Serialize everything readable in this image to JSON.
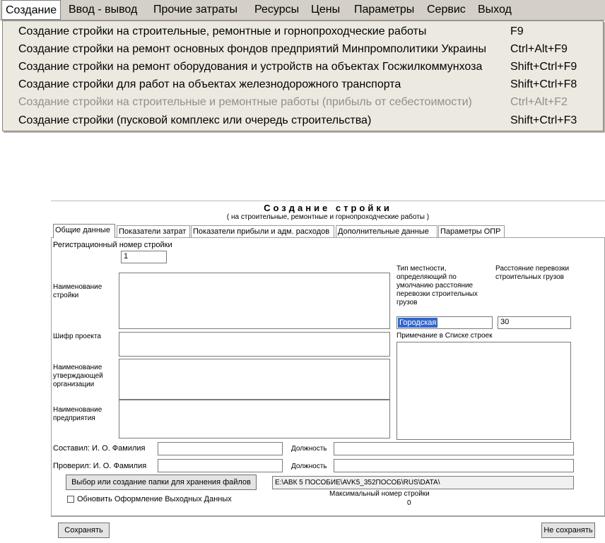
{
  "menubar": {
    "items": [
      "Создание",
      "Ввод - вывод",
      "Прочие затраты",
      "Ресурсы",
      "Цены",
      "Параметры",
      "Сервис",
      "Выход"
    ]
  },
  "dropdown": {
    "items": [
      {
        "label": "Создание стройки на строительные, ремонтные и горнопроходческие работы",
        "shortcut": "F9"
      },
      {
        "label": "Создание стройки на ремонт основных фондов предприятий Минпромполитики Украины",
        "shortcut": "Ctrl+Alt+F9"
      },
      {
        "label": "Создание стройки на ремонт оборудования и устройств на объектах Госжилкоммунхоза",
        "shortcut": "Shift+Ctrl+F9"
      },
      {
        "label": "Создание стройки для работ на объектах железнодорожного транспорта",
        "shortcut": "Shift+Ctrl+F8"
      },
      {
        "label": "Создание стройки на строительные и ремонтные работы (прибыль от себестоимости)",
        "shortcut": "Ctrl+Alt+F2"
      },
      {
        "label": "Создание стройки (пусковой комплекс или очередь строительства)",
        "shortcut": "Shift+Ctrl+F3"
      }
    ]
  },
  "dialog": {
    "title": "Создание стройки",
    "subtitle": "( на строительные, ремонтные  и горнопроходческие работы )",
    "tabs": [
      "Общие данные",
      "Показатели затрат",
      "Показатели прибыли и адм. расходов",
      "Дополнительные данные",
      "Параметры ОПР"
    ],
    "reg_number_label": "Регистрационный номер стройки",
    "reg_number_value": "1",
    "name_label": "Наименование стройки",
    "cipher_label": "Шифр проекта",
    "approving_org_label": "Наименование утверждающей организации",
    "enterprise_label": "Наименование предприятия",
    "terrain_label": "Тип местности, определяющий по умолчанию расстояние перевозки строительных грузов",
    "distance_label": "Расстояние перевозки строительных грузов",
    "terrain_value": "Городская",
    "distance_value": "30",
    "note_label": "Примечание в Списке строек",
    "composed_label": "Составил: И. О. Фамилия",
    "checked_label": "Проверил: И. О. Фамилия",
    "position_label": "Должность",
    "folder_button": "Выбор или создание папки для хранения файлов",
    "folder_path": "E:\\АВК 5 ПОСОБИЕ\\AVK5_352ПОСОБ\\RUS\\DATA\\",
    "update_checkbox_label": "Обновить Оформление Выходных Данных",
    "max_number_label": "Максимальный номер стройки",
    "max_number_value": "0",
    "save_button": "Сохранять",
    "dont_save_button": "Не сохранять"
  }
}
